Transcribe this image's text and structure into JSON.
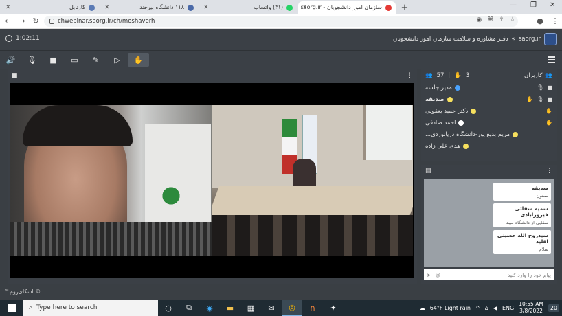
{
  "browser": {
    "tabs": [
      {
        "title": "کارتابل",
        "favicon_color": "#5b7bb5",
        "active": false
      },
      {
        "title": "۱۱۸ دانشگاه بیرجند",
        "favicon_color": "#4b6aa8",
        "active": false
      },
      {
        "title": "(۳۱) واتساپ",
        "favicon_color": "#25d366",
        "active": false
      },
      {
        "title": "سازمان امور دانشجویان - saorg.ir",
        "favicon_color": "#e53935",
        "active": true
      }
    ],
    "new_tab_label": "+",
    "url": "chwebinar.saorg.ir/ch/moshaverh"
  },
  "app": {
    "timer": "1:02:11",
    "site": "saorg.ir",
    "breadcrumb_sep": "»",
    "room_title": "دفتر مشاوره و سلامت سازمان امور دانشجویان"
  },
  "toolbar": {
    "tools": [
      {
        "name": "speaker-icon",
        "glyph": "🔊"
      },
      {
        "name": "microphone-icon",
        "glyph": "🎙"
      },
      {
        "name": "camera-icon",
        "glyph": "■"
      },
      {
        "name": "screen-share-icon",
        "glyph": "▭"
      },
      {
        "name": "brush-icon",
        "glyph": "✎"
      },
      {
        "name": "media-icon",
        "glyph": "▷"
      },
      {
        "name": "raise-hand-icon",
        "glyph": "✋"
      }
    ]
  },
  "users_panel": {
    "title": "کاربران",
    "hand_count": "3",
    "user_count": "57",
    "users": [
      {
        "name": "مدیر جلسه",
        "icon_color": "#4aa3ff",
        "mic": true,
        "cam": true,
        "hand": false
      },
      {
        "name": "صدیقه",
        "icon_color": "#f6e05e",
        "mic": true,
        "cam": true,
        "hand": true
      },
      {
        "name": "دکتر حمید یعقوبی",
        "icon_color": "#f6e05e",
        "mic": false,
        "cam": false,
        "hand": true
      },
      {
        "name": "احمد صادقی",
        "icon_color": "#ffffff",
        "mic": false,
        "cam": false,
        "hand": true
      },
      {
        "name": "مریم بدیع پور-دانشگاه دریانوردی...",
        "icon_color": "#f6e05e",
        "mic": false,
        "cam": false,
        "hand": false
      },
      {
        "name": "هدی علی زاده",
        "icon_color": "#f6e05e",
        "mic": false,
        "cam": false,
        "hand": false
      }
    ]
  },
  "chat": {
    "messages": [
      {
        "author": "صدیقه",
        "text": "ممنون"
      },
      {
        "author": "سمیه سقائی فیروزابادی",
        "text": "سقایی از دانشگاه میبد"
      },
      {
        "author": "سیدروح الله حسینی اقلید",
        "text": "سلام"
      }
    ],
    "input_placeholder": "پیام خود را وارد کنید"
  },
  "status": {
    "footer": "™اسکای‌روم ©"
  },
  "taskbar": {
    "search_placeholder": "Type here to search",
    "weather": "64°F  Light rain",
    "time": "10:55 AM",
    "date": "3/8/2022",
    "notif_count": "20",
    "lang": "ENG"
  }
}
